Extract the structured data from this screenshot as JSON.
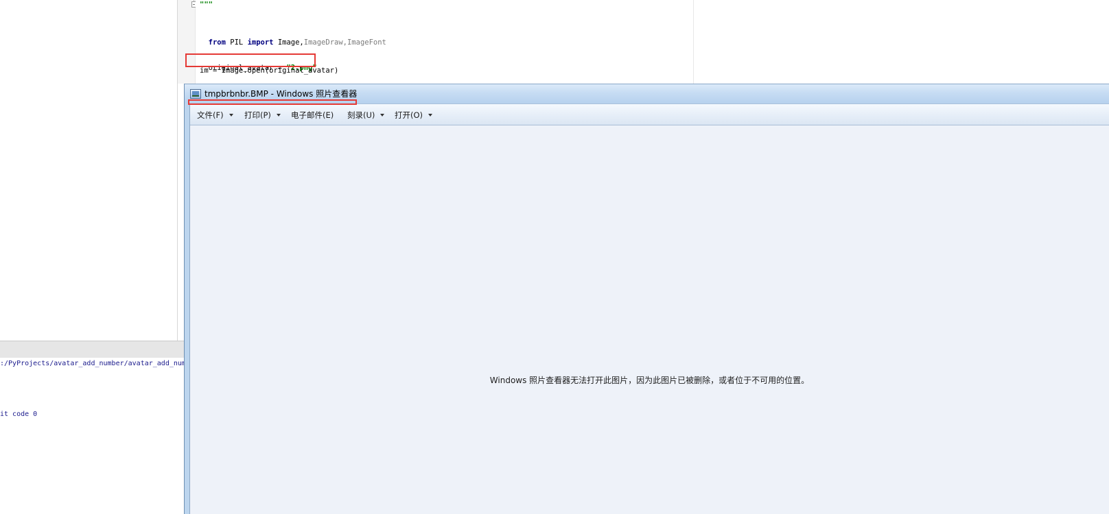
{
  "editor": {
    "lines": {
      "docstring": "\"\"\"",
      "import_kw_from": "from",
      "import_module": " PIL ",
      "import_kw_import": "import",
      "import_names_main": " Image,",
      "import_names_rest": "ImageDraw,ImageFont",
      "avatar_assign": "original_avatar = ",
      "avatar_value": "\"2.png\"",
      "open_line": "im = Image.open(original_avatar)"
    }
  },
  "console": {
    "path_line": ":/PyProjects/avatar_add_number/avatar_add_num",
    "exit_line": "it code 0"
  },
  "viewer": {
    "title": "tmpbrbnbr.BMP - Windows 照片查看器",
    "menu": [
      {
        "label": "文件(F)"
      },
      {
        "label": "打印(P)"
      },
      {
        "label": "电子邮件(E)"
      },
      {
        "label": "刻录(U)"
      },
      {
        "label": "打开(O)"
      }
    ],
    "message": "Windows 照片查看器无法打开此图片，因为此图片已被删除，或者位于不可用的位置。"
  },
  "colors": {
    "highlight_box": "#e53935",
    "keyword": "#000080",
    "string": "#008000"
  }
}
